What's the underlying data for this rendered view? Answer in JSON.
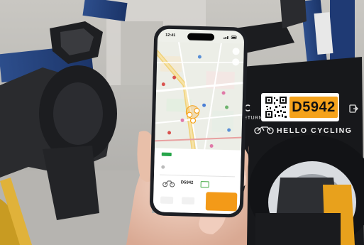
{
  "terminal": {
    "bike_id": "D5942",
    "brand_text": "HELLO CYCLING",
    "return_label": "RETURN",
    "accent_color": "#f5a21b"
  },
  "phone": {
    "status_time": "12:41",
    "panel": {
      "bike_id": "D5942",
      "action_color": "#f39a18"
    }
  },
  "icons": [
    "qr-code-icon",
    "bicycle-icon",
    "battery-icon",
    "map-location-icon",
    "search-icon"
  ]
}
